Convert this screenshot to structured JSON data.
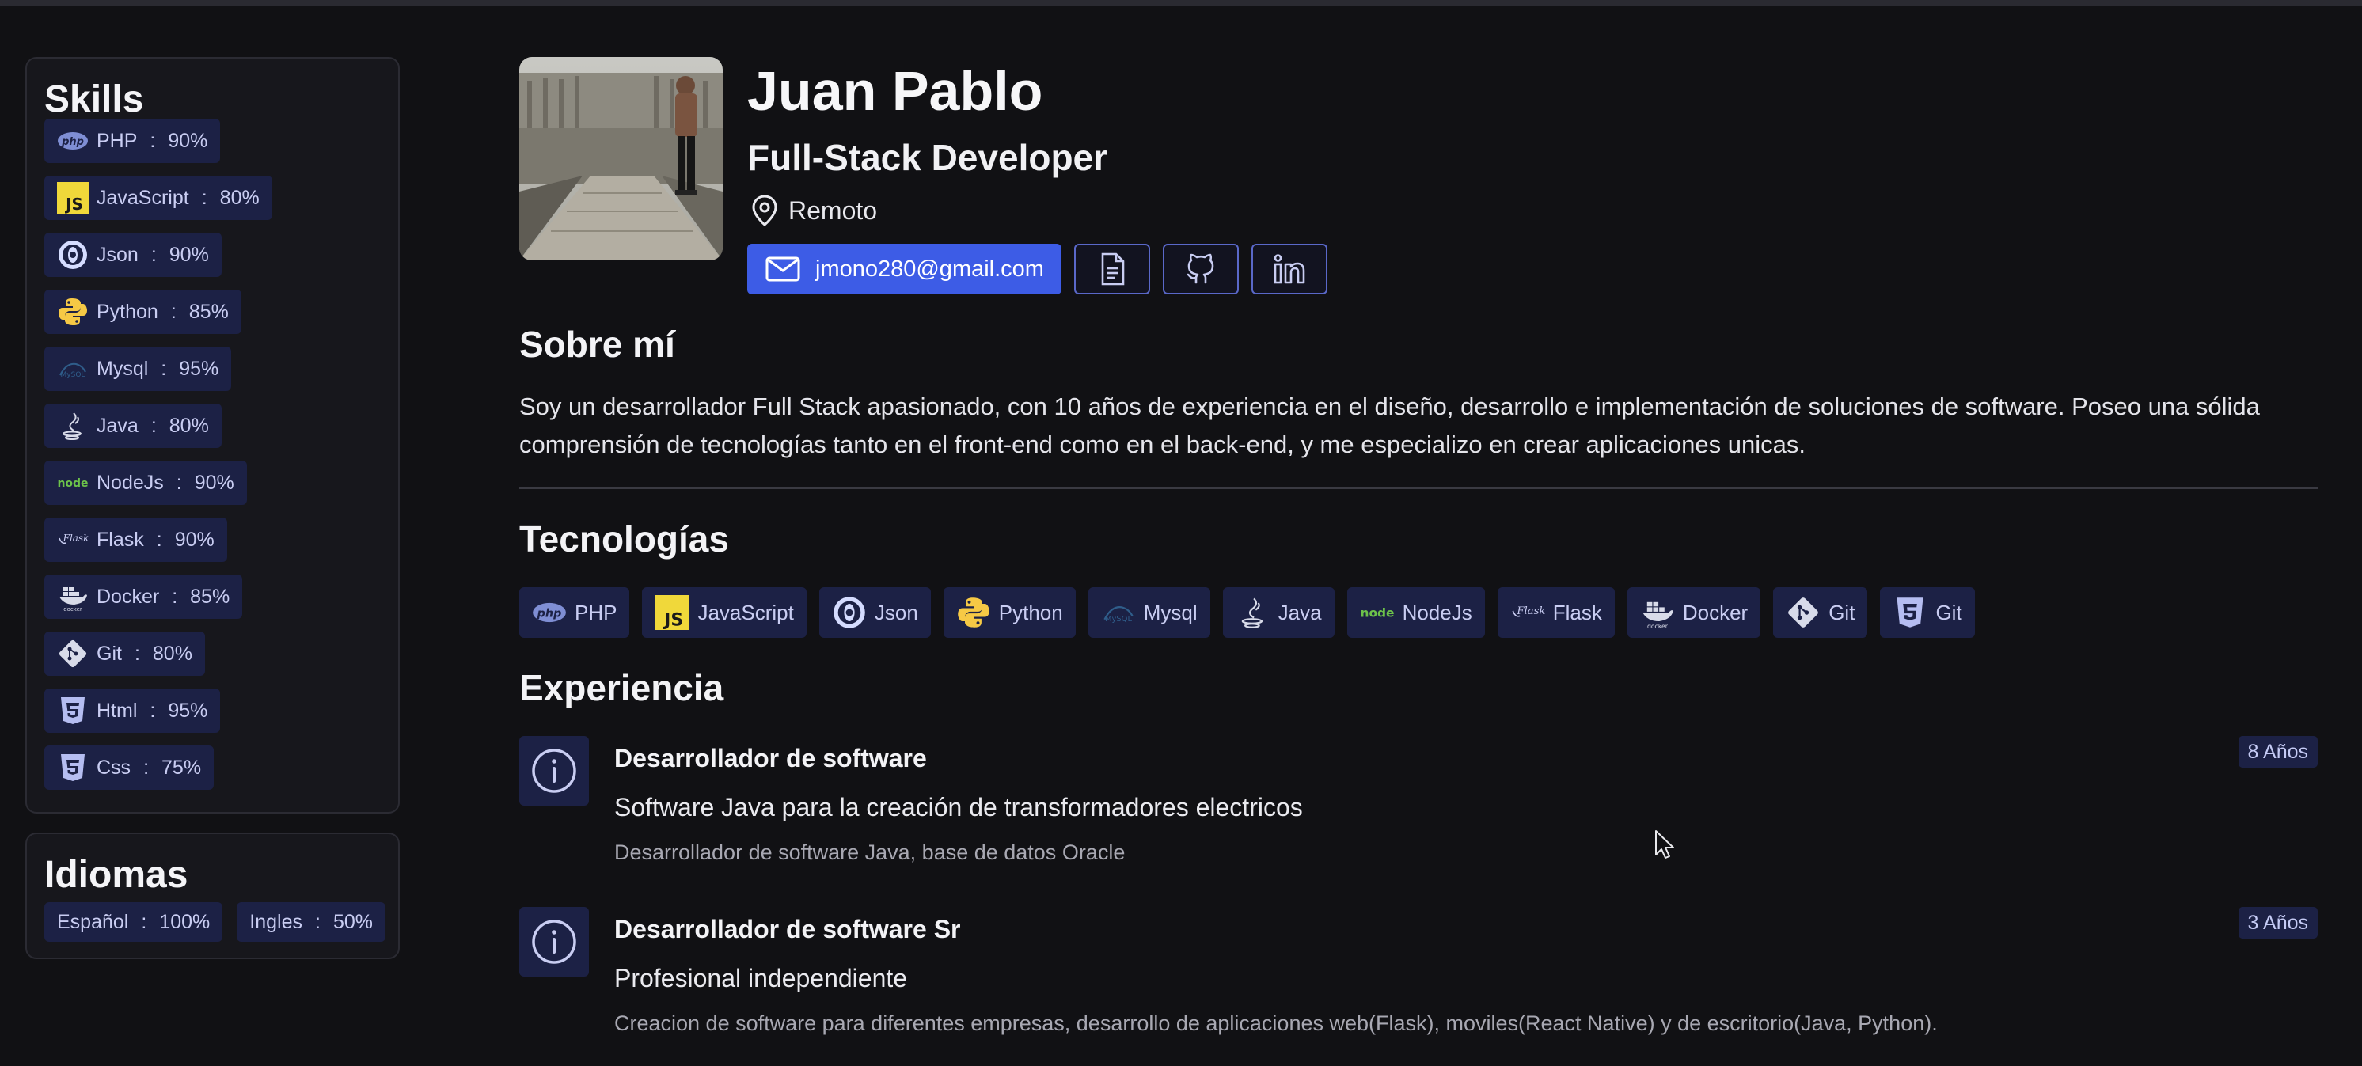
{
  "sidebar": {
    "skills_title": "Skills",
    "skills": [
      {
        "name": "PHP",
        "level": "90%",
        "icon": "php-icon"
      },
      {
        "name": "JavaScript",
        "level": "80%",
        "icon": "javascript-icon"
      },
      {
        "name": "Json",
        "level": "90%",
        "icon": "json-icon"
      },
      {
        "name": "Python",
        "level": "85%",
        "icon": "python-icon"
      },
      {
        "name": "Mysql",
        "level": "95%",
        "icon": "mysql-icon"
      },
      {
        "name": "Java",
        "level": "80%",
        "icon": "java-icon"
      },
      {
        "name": "NodeJs",
        "level": "90%",
        "icon": "nodejs-icon"
      },
      {
        "name": "Flask",
        "level": "90%",
        "icon": "flask-icon"
      },
      {
        "name": "Docker",
        "level": "85%",
        "icon": "docker-icon"
      },
      {
        "name": "Git",
        "level": "80%",
        "icon": "git-icon"
      },
      {
        "name": "Html",
        "level": "95%",
        "icon": "html5-icon"
      },
      {
        "name": "Css",
        "level": "75%",
        "icon": "css-icon"
      }
    ],
    "languages_title": "Idiomas",
    "languages": [
      {
        "name": "Español",
        "level": "100%"
      },
      {
        "name": "Ingles",
        "level": "50%"
      }
    ],
    "separator": ":"
  },
  "profile": {
    "name": "Juan Pablo",
    "role": "Full-Stack Developer",
    "location": "Remoto",
    "email": "jmono280@gmail.com"
  },
  "about": {
    "title": "Sobre mí",
    "text": "Soy un desarrollador Full Stack apasionado, con 10 años de experiencia en el diseño, desarrollo e implementación de soluciones de software. Poseo una sólida comprensión de tecnologías tanto en el front-end como en el back-end, y me especializo en crear aplicaciones unicas."
  },
  "technologies": {
    "title": "Tecnologías",
    "items": [
      {
        "name": "PHP",
        "icon": "php-icon"
      },
      {
        "name": "JavaScript",
        "icon": "javascript-icon"
      },
      {
        "name": "Json",
        "icon": "json-icon"
      },
      {
        "name": "Python",
        "icon": "python-icon"
      },
      {
        "name": "Mysql",
        "icon": "mysql-icon"
      },
      {
        "name": "Java",
        "icon": "java-icon"
      },
      {
        "name": "NodeJs",
        "icon": "nodejs-icon"
      },
      {
        "name": "Flask",
        "icon": "flask-icon"
      },
      {
        "name": "Docker",
        "icon": "docker-icon"
      },
      {
        "name": "Git",
        "icon": "git-icon"
      },
      {
        "name": "Git",
        "icon": "html5-icon"
      }
    ]
  },
  "experience": {
    "title": "Experiencia",
    "items": [
      {
        "title": "Desarrollador de software",
        "subtitle": "Software Java para la creación de transformadores electricos",
        "description": "Desarrollador de software Java, base de datos Oracle",
        "duration": "8 Años"
      },
      {
        "title": "Desarrollador de software Sr",
        "subtitle": "Profesional independiente",
        "description": "Creacion de software para diferentes empresas, desarrollo de aplicaciones web(Flask), moviles(React Native) y de escritorio(Java, Python).",
        "duration": "3 Años"
      }
    ]
  },
  "colors": {
    "background": "#111114",
    "chip_bg": "#1c2145",
    "chip_text": "#c9cdf2",
    "accent": "#3d5ce6"
  }
}
